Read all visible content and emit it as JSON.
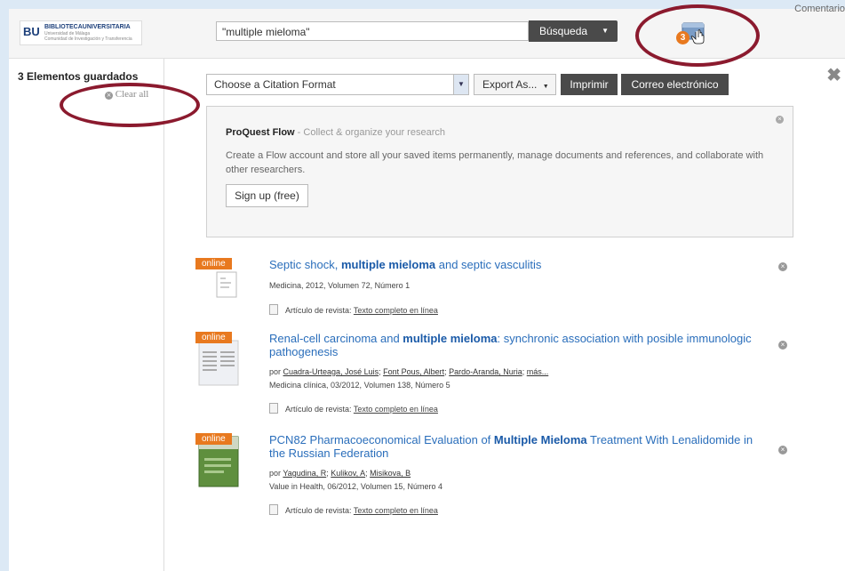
{
  "header": {
    "logo_bu": "BU",
    "logo_title": "BIBLIOTECAUNIVERSITARIA",
    "logo_sub1": "Universidad de Málaga",
    "logo_sub2": "Comunidad de Investigación y Transferencia",
    "search_value": "\"multiple mieloma\"",
    "search_button": "Búsqueda",
    "comment_link": "Comentario",
    "saved_badge": "3"
  },
  "sidebar": {
    "saved_count": "3 Elementos guardados",
    "clear_all": "Clear all"
  },
  "toolbar": {
    "citation_placeholder": "Choose a Citation Format",
    "export_label": "Export As...",
    "print_label": "Imprimir",
    "email_label": "Correo electrónico"
  },
  "flow": {
    "title_bold": "ProQuest Flow",
    "title_rest": " - Collect & organize your research",
    "description": "Create a Flow account and store all your saved items permanently, manage documents and references, and collaborate with other researchers.",
    "signup_label": "Sign up (free)"
  },
  "results": [
    {
      "badge": "online",
      "title_pre": "Septic shock, ",
      "title_bold": "multiple mieloma",
      "title_post": " and septic vasculitis",
      "authors_prefix": "",
      "authors": [],
      "source": "Medicina, 2012, Volumen 72, Número 1",
      "type_label": "Artículo de revista:",
      "fulltext": "Texto completo en línea"
    },
    {
      "badge": "online",
      "title_pre": "Renal-cell carcinoma and ",
      "title_bold": "multiple mieloma",
      "title_post": ": synchronic association with posible immunologic pathogenesis",
      "authors_prefix": "por",
      "authors": [
        "Cuadra-Urteaga, José Luis",
        "Font Pous, Albert",
        "Pardo-Aranda, Nuria",
        "más..."
      ],
      "source": "Medicina clínica, 03/2012, Volumen 138, Número 5",
      "type_label": "Artículo de revista:",
      "fulltext": "Texto completo en línea"
    },
    {
      "badge": "online",
      "title_pre": "PCN82 Pharmacoeconomical Evaluation of ",
      "title_bold": "Multiple Mieloma",
      "title_post": " Treatment With Lenalidomide in the Russian Federation",
      "authors_prefix": "por",
      "authors": [
        "Yagudina, R",
        "Kulikov, A",
        "Misikova, B"
      ],
      "source": "Value in Health, 06/2012, Volumen 15, Número 4",
      "type_label": "Artículo de revista:",
      "fulltext": "Texto completo en línea"
    }
  ],
  "colors": {
    "accent_orange": "#e8791f",
    "link_blue": "#2a6ebb",
    "dark_button": "#4a4a4a",
    "annotation_oval": "#8b1a2e"
  }
}
